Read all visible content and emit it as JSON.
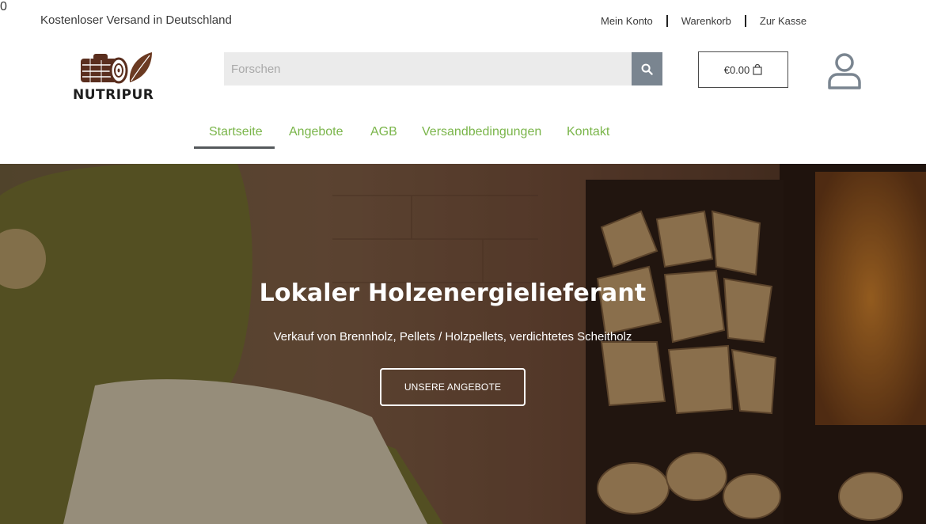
{
  "topbar": {
    "promo": "Kostenloser Versand in Deutschland",
    "links": [
      "Mein Konto",
      "Warenkorb",
      "Zur Kasse"
    ]
  },
  "logo": {
    "text": "NUTRIPUR"
  },
  "search": {
    "placeholder": "Forschen"
  },
  "cart": {
    "total": "€0.00",
    "count": "0"
  },
  "nav": {
    "items": [
      "Startseite",
      "Angebote",
      "AGB",
      "Versandbedingungen",
      "Kontakt"
    ],
    "active": "Startseite"
  },
  "hero": {
    "title": "Lokaler Holzenergielieferant",
    "subtitle": "Verkauf von Brennholz, Pellets / Holzpellets, verdichtetes Scheitholz",
    "cta": "UNSERE ANGEBOTE"
  },
  "colors": {
    "accent_green": "#7ab54a",
    "search_button": "#7a8590",
    "badge": "#d9413a",
    "logo_brown": "#5a2e1e"
  },
  "icons": {
    "search": "search-icon",
    "cart": "shopping-bag-icon",
    "user": "user-icon",
    "logo": "log-leaf-logo"
  }
}
